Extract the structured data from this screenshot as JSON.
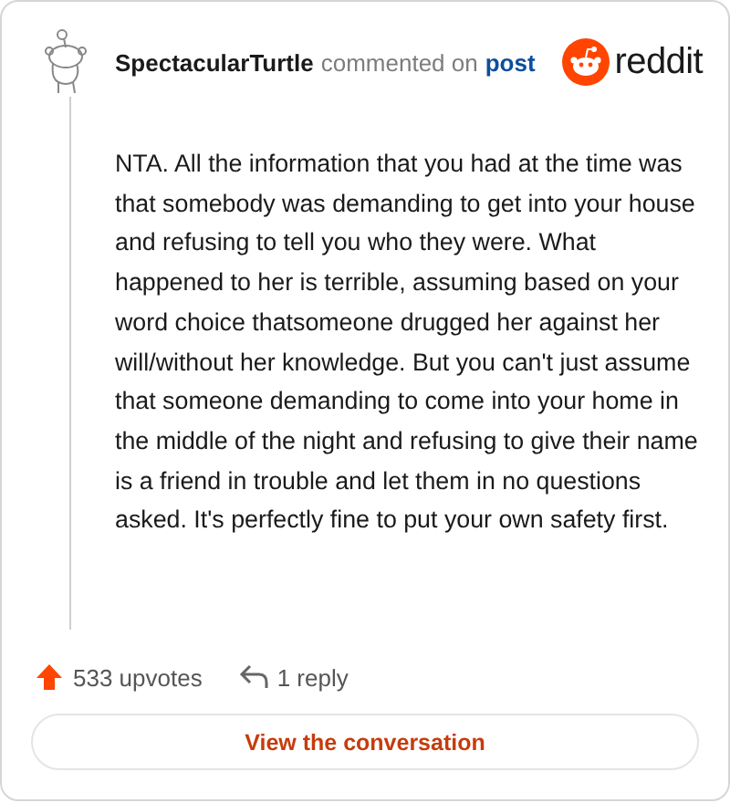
{
  "header": {
    "username": "SpectacularTurtle",
    "action": "commented on",
    "link": "post",
    "brand": "reddit"
  },
  "comment": {
    "body": "NTA. All the information that you had at the time was that somebody was demanding to get into your house and refusing to tell you who they were. What happened to her is terrible, assuming based on your word choice thatsomeone drugged her against her will/without her knowledge. But you can't just assume that someone demanding to come into your home in the middle of the night and refusing to give their name is a friend in trouble and let them in no questions asked. It's perfectly fine to put your own safety first."
  },
  "footer": {
    "upvotes": "533 upvotes",
    "replies": "1 reply"
  },
  "button": {
    "label": "View the conversation"
  }
}
